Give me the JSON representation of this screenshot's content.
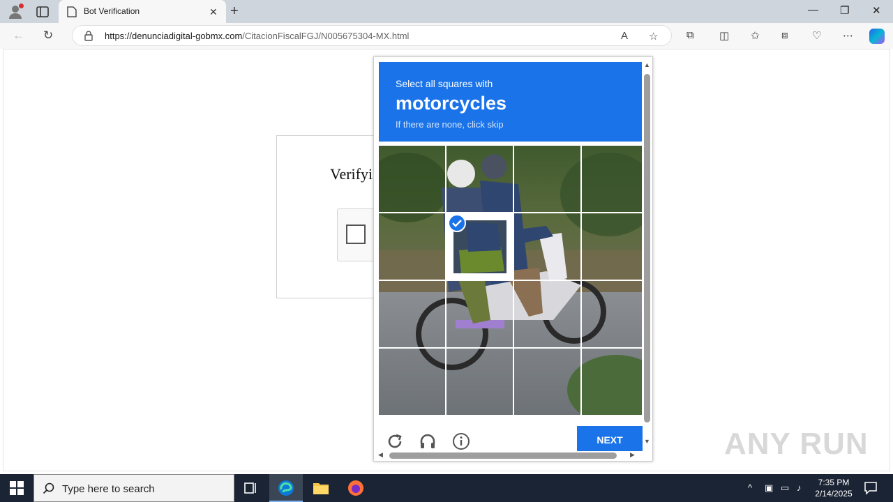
{
  "browser": {
    "tab_title": "Bot Verification",
    "close_tab": "✕",
    "new_tab": "+",
    "url_host": "https://denunciadigital-gobmx.com",
    "url_path": "/CitacionFiscalFGJ/N005675304-MX.html",
    "min": "—",
    "max": "❐",
    "close": "✕"
  },
  "page": {
    "verify_text": "Verifyi"
  },
  "captcha": {
    "prompt_line1": "Select all squares with",
    "prompt_object": "motorcycles",
    "prompt_line3": "If there are none, click skip",
    "next_label": "NEXT",
    "selected_tile": "row 2, column 2"
  },
  "watermark": "ANY RUN",
  "taskbar": {
    "search_placeholder": "Type here to search",
    "time": "7:35 PM",
    "date": "2/14/2025"
  }
}
